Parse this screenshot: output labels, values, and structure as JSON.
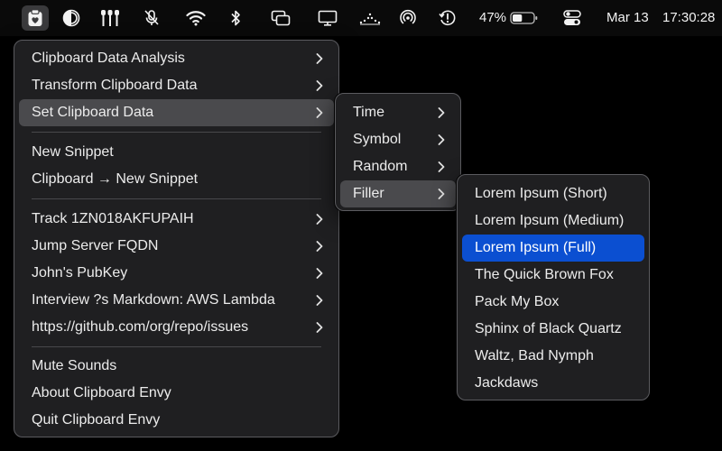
{
  "menubar": {
    "icons": [
      {
        "name": "clipboard-envy-icon",
        "active": true
      },
      {
        "name": "contrast-icon"
      },
      {
        "name": "bartender-icon"
      },
      {
        "name": "microphone-muted-icon"
      },
      {
        "name": "wifi-icon"
      },
      {
        "name": "bluetooth-icon"
      },
      {
        "name": "screen-mirroring-icon"
      },
      {
        "name": "display-icon"
      },
      {
        "name": "stats-icon"
      },
      {
        "name": "airdrop-icon"
      },
      {
        "name": "time-machine-icon"
      },
      {
        "name": "battery-icon"
      },
      {
        "name": "control-center-icon"
      }
    ],
    "battery_percent": "47%",
    "battery_level": 0.47,
    "date": "Mar 13",
    "time": "17:30:28"
  },
  "main_menu": {
    "items": [
      {
        "label": "Clipboard Data Analysis",
        "submenu": true
      },
      {
        "label": "Transform Clipboard Data",
        "submenu": true
      },
      {
        "label": "Set Clipboard Data",
        "submenu": true,
        "state": "highlighted"
      },
      {
        "label": "New Snippet",
        "submenu": false
      },
      {
        "label": "Clipboard → New Snippet",
        "submenu": false
      },
      {
        "label": "Track 1ZN018AKFUPAIH",
        "submenu": true
      },
      {
        "label": "Jump Server FQDN",
        "submenu": true
      },
      {
        "label": "John's PubKey",
        "submenu": true
      },
      {
        "label": "Interview ?s Markdown: AWS Lambda",
        "submenu": true
      },
      {
        "label": "https://github.com/org/repo/issues",
        "submenu": true
      },
      {
        "label": "Mute Sounds",
        "submenu": false
      },
      {
        "label": "About Clipboard Envy",
        "submenu": false
      },
      {
        "label": "Quit Clipboard Envy",
        "submenu": false
      }
    ]
  },
  "set_data_submenu": {
    "items": [
      {
        "label": "Time",
        "submenu": true
      },
      {
        "label": "Symbol",
        "submenu": true
      },
      {
        "label": "Random",
        "submenu": true
      },
      {
        "label": "Filler",
        "submenu": true,
        "state": "highlighted"
      }
    ]
  },
  "filler_submenu": {
    "items": [
      {
        "label": "Lorem Ipsum (Short)"
      },
      {
        "label": "Lorem Ipsum (Medium)"
      },
      {
        "label": "Lorem Ipsum (Full)",
        "state": "selected"
      },
      {
        "label": "The Quick Brown Fox"
      },
      {
        "label": "Pack My Box"
      },
      {
        "label": "Sphinx of Black Quartz"
      },
      {
        "label": "Waltz, Bad Nymph"
      },
      {
        "label": "Jackdaws"
      }
    ]
  },
  "colors": {
    "selection": "#0b4fd1",
    "hover": "#4a4a4d",
    "menu_bg": "#1f1f21"
  }
}
